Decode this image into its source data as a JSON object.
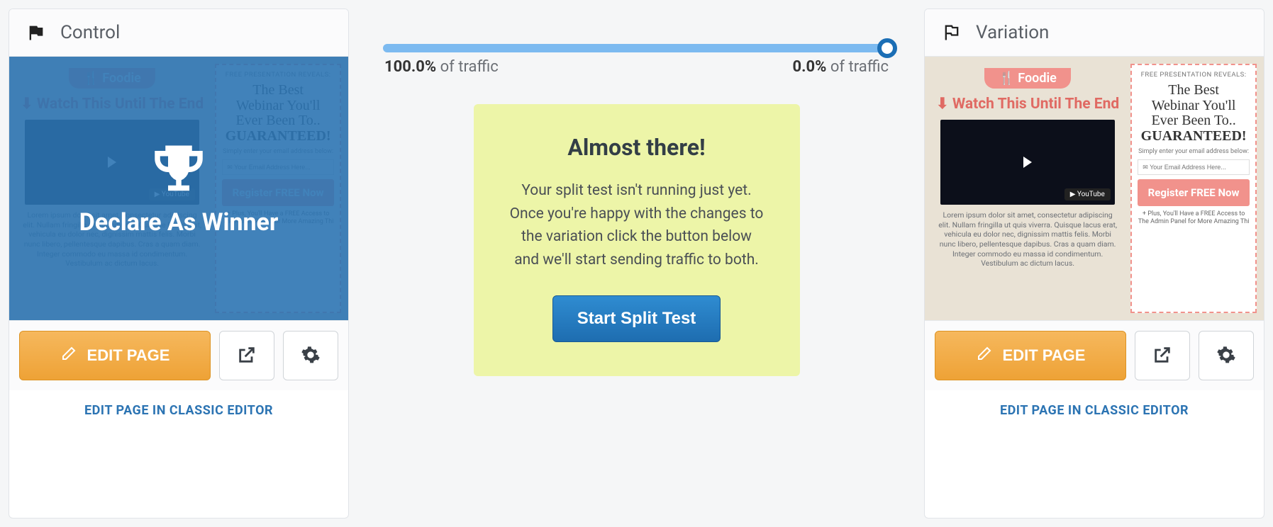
{
  "control": {
    "title": "Control",
    "overlay": "Declare As Winner",
    "edit_label": "EDIT PAGE",
    "classic_link": "EDIT PAGE IN CLASSIC EDITOR"
  },
  "variation": {
    "title": "Variation",
    "edit_label": "EDIT PAGE",
    "classic_link": "EDIT PAGE IN CLASSIC EDITOR"
  },
  "slider": {
    "left_pct": "100.0%",
    "left_suffix": " of traffic",
    "right_pct": "0.0%",
    "right_suffix": " of traffic"
  },
  "almost": {
    "title": "Almost there!",
    "body": "Your split test isn't running just yet. Once you're happy with the changes to the variation click the button below and we'll start sending traffic to both.",
    "button": "Start Split Test"
  },
  "lp": {
    "badge": "🍴 Foodie",
    "watch": "⬇ Watch This Until The End",
    "youtube": "▶ YouTube",
    "lorem": "Lorem ipsum dolor sit amet, consectetur adipiscing elit. Nullam fringilla ut quis viverra. Quisque lacus erat, vehicula eu dolor nec, dignissim mattis felis. Morbi nunc libero, pellentesque dapibus. Cras a quam diam. Integer commodo eu massa id condimentum. Vestibulum ac dictum lacus.",
    "free": "FREE PRESENTATION REVEALS:",
    "webinar_line1": "The Best",
    "webinar_line2": "Webinar You'll",
    "webinar_line3": "Ever Been To..",
    "guaranteed": "GUARANTEED!",
    "simply": "Simply enter your email address below:",
    "email_placeholder": "✉ Your Email Address Here...",
    "register": "Register FREE Now",
    "plus": "+ Plus, You'll Have a FREE Access to The Admin Panel for More Amazing Thi"
  }
}
